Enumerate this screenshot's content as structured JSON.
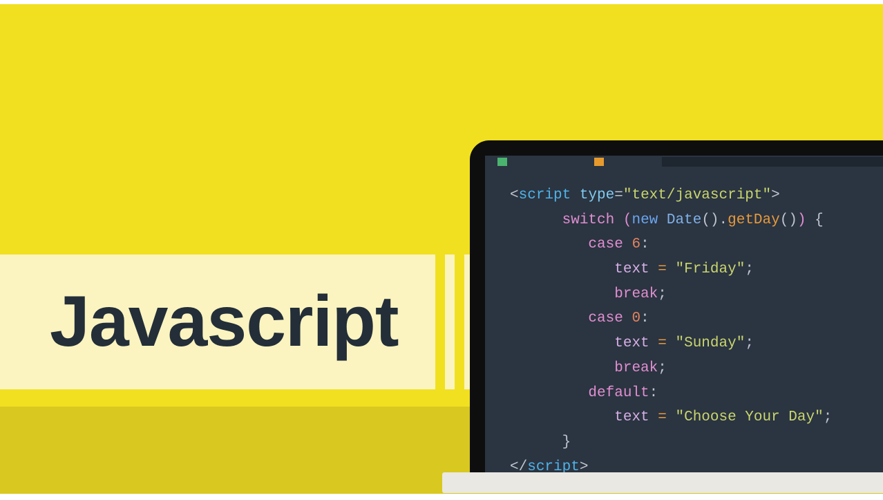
{
  "title": "Javascript",
  "code": {
    "l1_open": "<",
    "l1_tag": "script",
    "l1_space": " ",
    "l1_attr": "type",
    "l1_eq": "=",
    "l1_str": "\"text/javascript\"",
    "l1_close": ">",
    "l2_kw": "switch",
    "l2_sp": " ",
    "l2_po": "(",
    "l2_new": "new",
    "l2_sp2": " ",
    "l2_cls": "Date",
    "l2_call": "().",
    "l2_m": "getDay",
    "l2_call2": "()",
    "l2_pc": ")",
    "l2_br": " {",
    "l3_case": "case",
    "l3_sp": " ",
    "l3_n": "6",
    "l3_col": ":",
    "l4_v": "text",
    "l4_sp": " ",
    "l4_eq": "=",
    "l4_sp2": " ",
    "l4_s": "\"Friday\"",
    "l4_sc": ";",
    "l5_br": "break",
    "l5_sc": ";",
    "l6_case": "case",
    "l6_sp": " ",
    "l6_n": "0",
    "l6_col": ":",
    "l7_v": "text",
    "l7_sp": " ",
    "l7_eq": "=",
    "l7_sp2": " ",
    "l7_s": "\"Sunday\"",
    "l7_sc": ";",
    "l8_br": "break",
    "l8_sc": ";",
    "l9_def": "default",
    "l9_col": ":",
    "l10_v": "text",
    "l10_sp": " ",
    "l10_eq": "=",
    "l10_sp2": " ",
    "l10_s": "\"Choose Your Day\"",
    "l10_sc": ";",
    "l11_cb": "}",
    "l12_open": "</",
    "l12_tag": "script",
    "l12_close": ">"
  }
}
